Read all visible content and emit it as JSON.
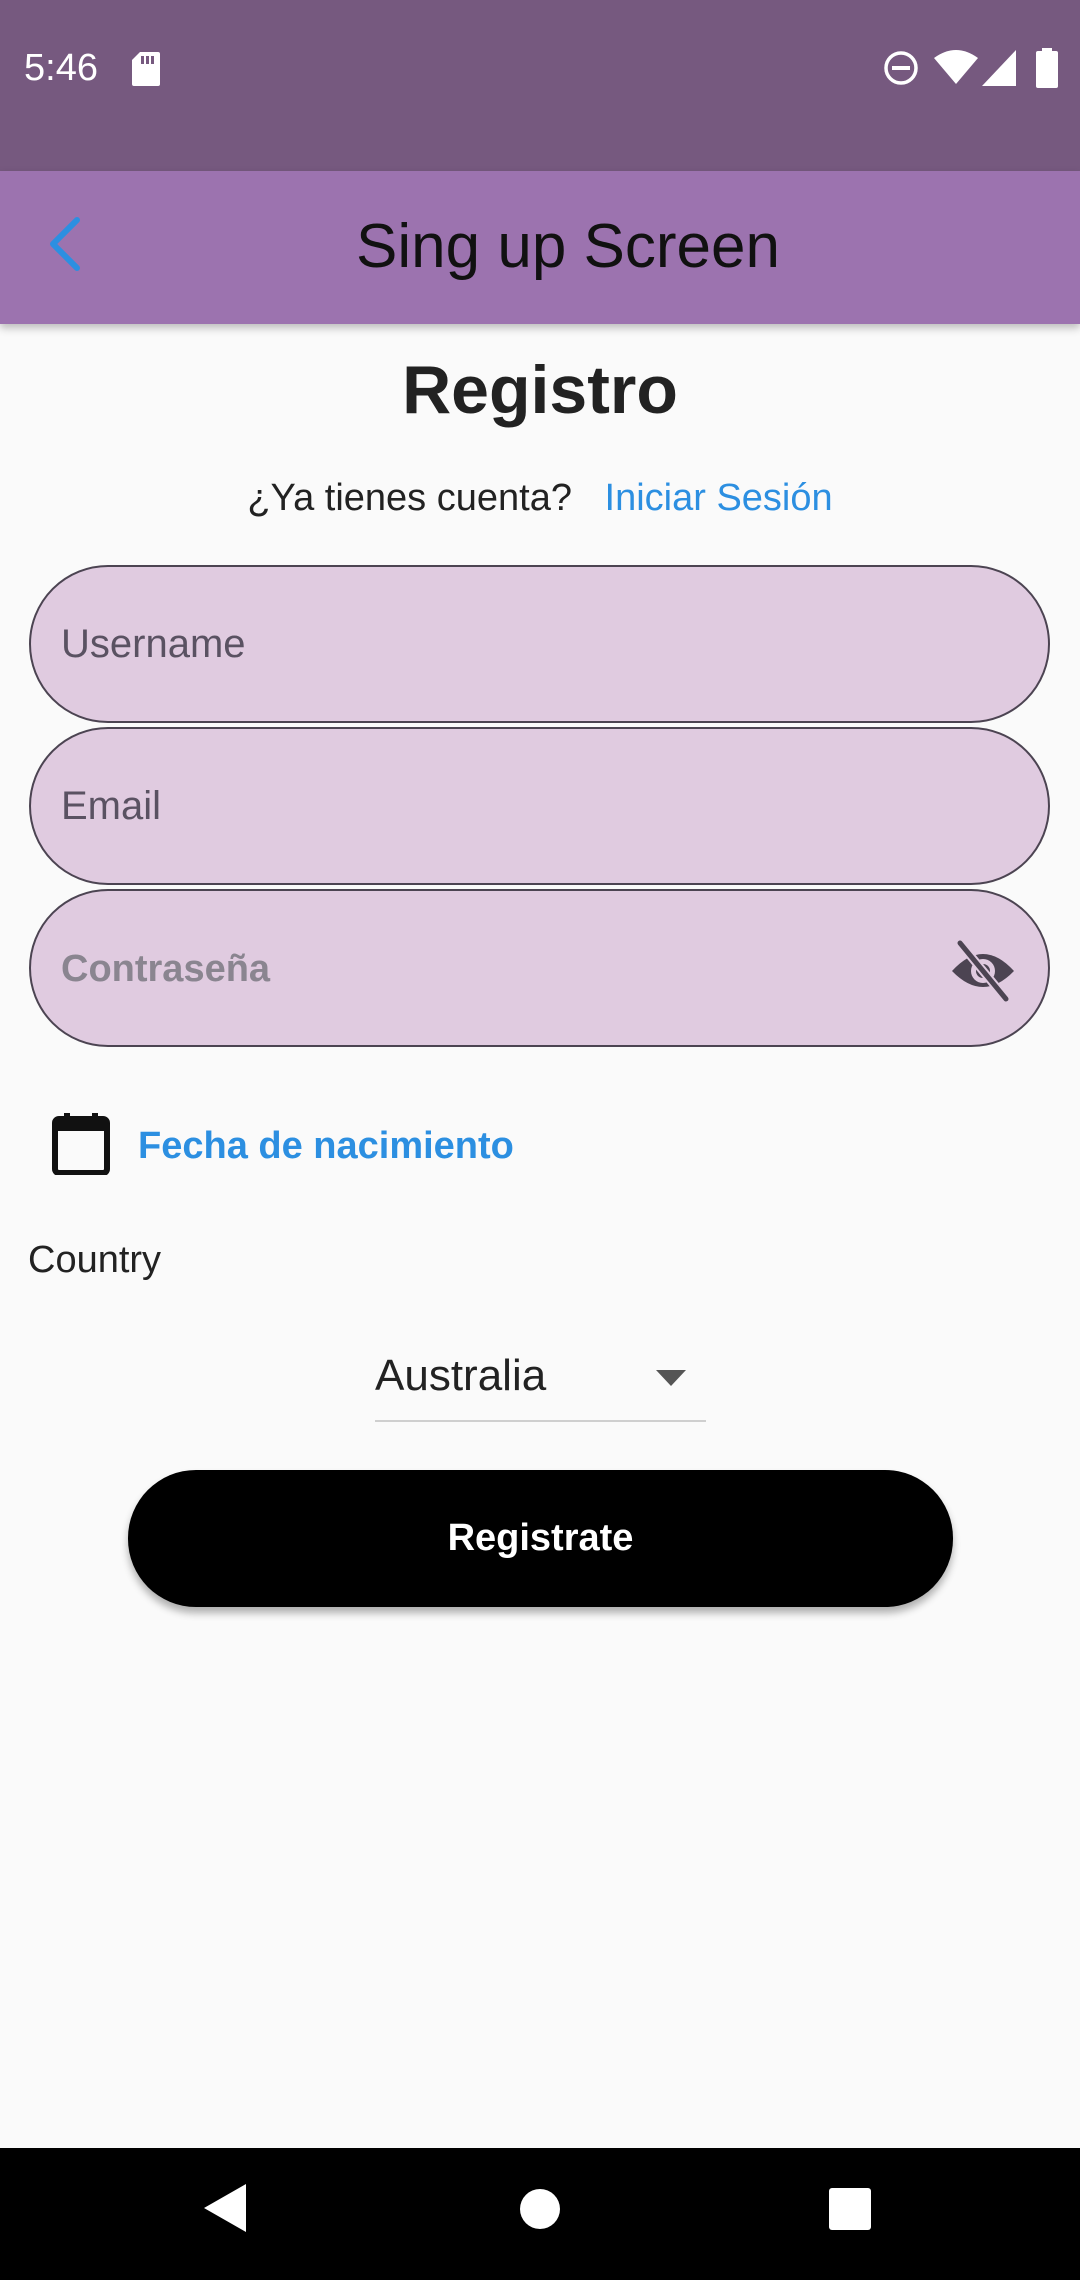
{
  "status_bar": {
    "time": "5:46",
    "icons": [
      "sd-card-icon",
      "do-not-disturb-icon",
      "wifi-icon",
      "signal-icon",
      "battery-icon"
    ]
  },
  "app_bar": {
    "title": "Sing up Screen",
    "back_icon": "chevron-left-icon"
  },
  "form": {
    "heading": "Registro",
    "login_prompt": "¿Ya tienes cuenta?",
    "login_link": "Iniciar Sesión",
    "username": {
      "placeholder": "Username",
      "value": ""
    },
    "email": {
      "placeholder": "Email",
      "value": ""
    },
    "password": {
      "placeholder": "Contraseña",
      "value": "",
      "visibility_icon": "eye-off-icon"
    },
    "birthdate_label": "Fecha de nacimiento",
    "country_label": "Country",
    "country_selected": "Australia",
    "submit_label": "Registrate"
  },
  "nav_bar": {
    "buttons": [
      "back-triangle-icon",
      "home-circle-icon",
      "recents-square-icon"
    ]
  },
  "colors": {
    "status_bar": "#76597f",
    "app_bar": "#9c73af",
    "accent_link": "#2c8fe1",
    "field_fill": "#e0cbe0",
    "button": "#000000"
  }
}
